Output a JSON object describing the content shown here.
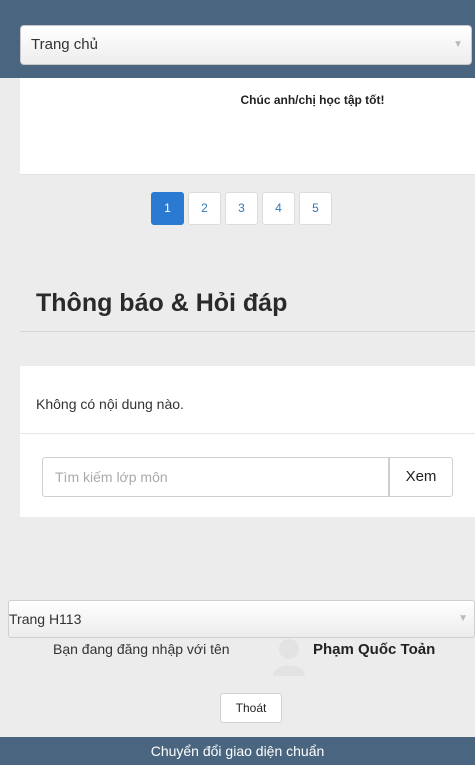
{
  "header": {
    "page_select_value": "Trang chủ"
  },
  "notice": {
    "message": "Chúc anh/chị học tập tốt!"
  },
  "pagination": {
    "pages": [
      "1",
      "2",
      "3",
      "4",
      "5"
    ],
    "active": "1"
  },
  "qa": {
    "title": "Thông báo & Hỏi đáp",
    "empty_text": "Không có nội dung nào.",
    "search_placeholder": "Tìm kiếm lớp môn",
    "search_button": "Xem"
  },
  "footer": {
    "theme_select_value": "Trang H113",
    "logged_in_prefix": "Bạn đang đăng nhập với tên",
    "username": "Phạm Quốc Toản",
    "logout_label": "Thoát",
    "switch_label": "Chuyển đổi giao diện chuẩn"
  }
}
